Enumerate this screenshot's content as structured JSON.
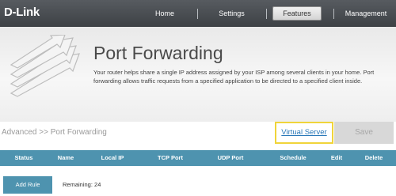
{
  "header": {
    "logo": "D-Link",
    "nav": [
      "Home",
      "Settings",
      "Features",
      "Management"
    ],
    "active_nav": "Features"
  },
  "hero": {
    "title": "Port Forwarding",
    "description": "Your router helps share a single IP address assigned by your ISP among several clients in your home. Port forwarding allows traffic requests from a specified application to be directed to a specified client inside.",
    "icon": "port-forwarding-arrows-icon"
  },
  "toolbar": {
    "breadcrumb": "Advanced >> Port Forwarding",
    "virtual_server_label": "Virtual Server",
    "save_label": "Save"
  },
  "table": {
    "columns": [
      "Status",
      "Name",
      "Local IP",
      "TCP Port",
      "UDP Port",
      "Schedule",
      "Edit",
      "Delete"
    ]
  },
  "footer": {
    "add_rule_label": "Add Rule",
    "remaining_text": "Remaining: 24"
  },
  "colors": {
    "header_bg": "#4a4e52",
    "accent_blue": "#4e93af",
    "highlight": "#f0d43a"
  }
}
